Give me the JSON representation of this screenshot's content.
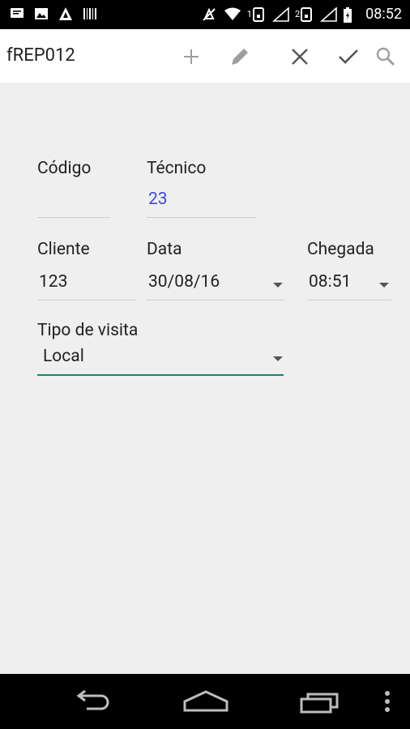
{
  "status_bar": {
    "time": "08:52",
    "left_icons": [
      "message-icon",
      "image-icon",
      "app-icon",
      "barcode-icon"
    ],
    "right_icons": [
      "mute-icon",
      "wifi-icon",
      "sim1-icon",
      "signal1-icon",
      "sim2-icon",
      "signal2-icon",
      "battery-icon"
    ],
    "sim1_label": "1",
    "sim2_label": "2"
  },
  "toolbar": {
    "title": "fREP012",
    "buttons": [
      "add-icon",
      "edit-icon",
      "close-icon",
      "check-icon",
      "search-icon"
    ]
  },
  "form": {
    "codigo": {
      "label": "Código",
      "value": ""
    },
    "tecnico": {
      "label": "Técnico",
      "value": "23"
    },
    "cliente": {
      "label": "Cliente",
      "value": "123"
    },
    "data": {
      "label": "Data",
      "value": "30/08/16"
    },
    "chegada": {
      "label": "Chegada",
      "value": "08:51"
    },
    "tipo_visita": {
      "label": "Tipo de visita",
      "value": "Local"
    },
    "accent_color": "#0f8a73",
    "link_color": "#3d4bd6"
  },
  "nav_bar": {
    "buttons": [
      "back-icon",
      "home-icon",
      "recents-icon",
      "menu-icon"
    ]
  }
}
